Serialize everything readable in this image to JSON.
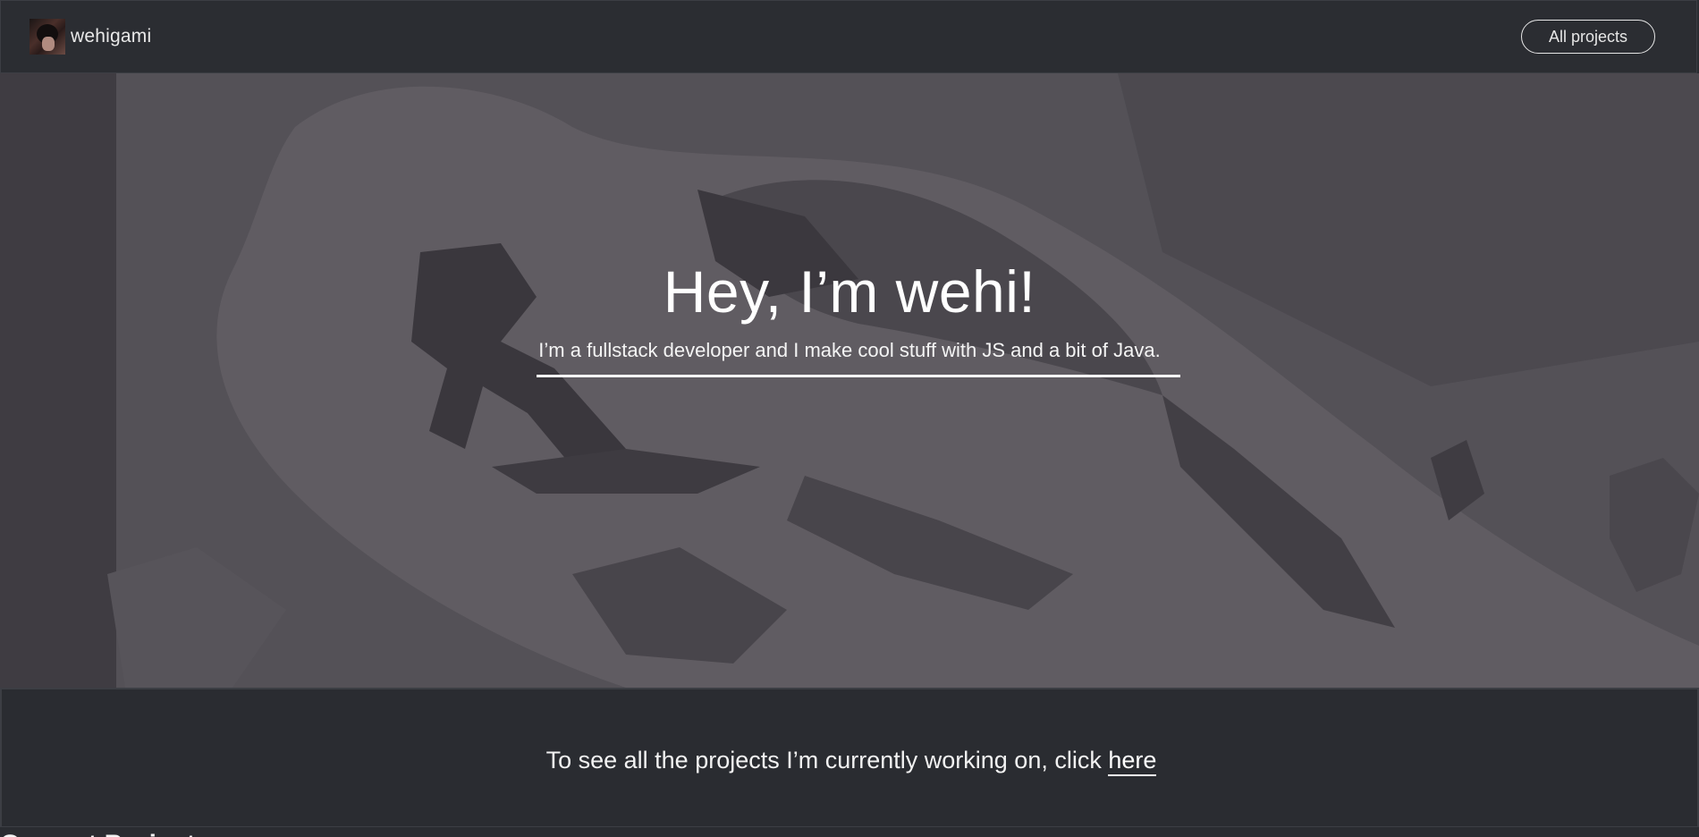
{
  "navbar": {
    "brand_name": "wehigami",
    "all_projects_label": "All projects"
  },
  "hero": {
    "title": "Hey, I’m wehi!",
    "subtitle": "I’m a fullstack developer and I make cool stuff with JS and a bit of Java."
  },
  "cta": {
    "text": "To see all the projects I’m currently working on, click ",
    "link_label": "here"
  },
  "projects_section": {
    "heading": "Current Projects"
  },
  "colors": {
    "background": "#2a2c31",
    "hero_overlay": "#4e4b51",
    "text": "#ffffff"
  }
}
